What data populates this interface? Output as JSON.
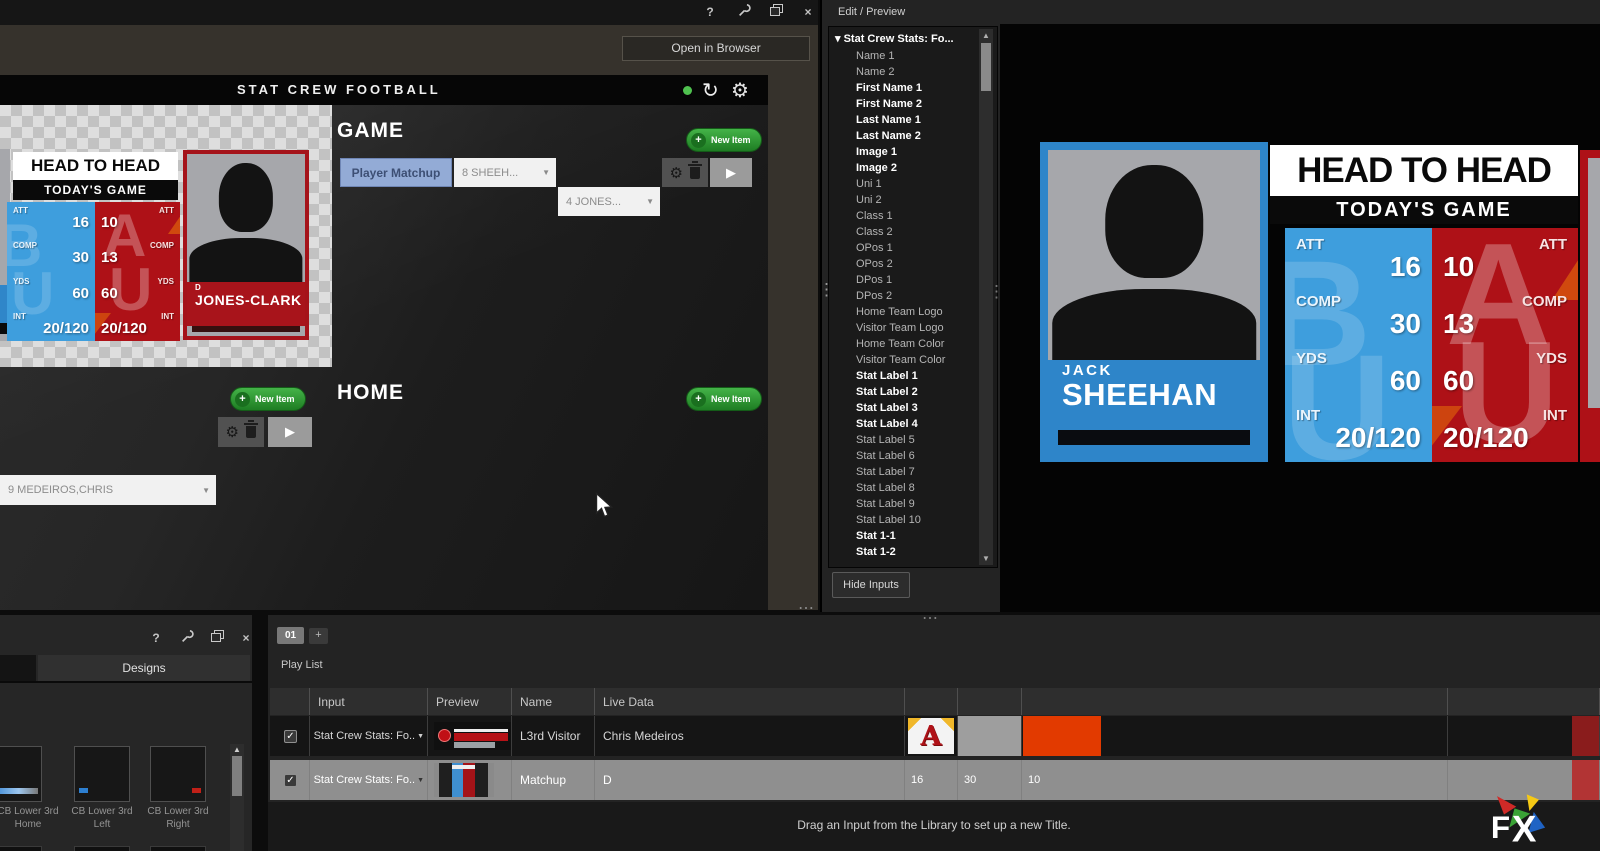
{
  "icons": {
    "help": "?",
    "close": "×",
    "refresh": "↻",
    "gear": "⚙",
    "play": "▶",
    "dropdown_arrow": "▼",
    "collapse_arrow": "▾",
    "scroll_up": "▲",
    "scroll_down": "▼",
    "check": "✓",
    "add": "+",
    "dots_v": "⋮",
    "dots_h": "⋯"
  },
  "colors": {
    "accent_green": "#2f9b32",
    "chip_blue": "#93abd6",
    "team_blue": "#3e9edd",
    "team_red": "#ae1117",
    "orange_swatch": "#e23a00",
    "status_green": "#4fc14f"
  },
  "window": {
    "title": "STAT CREW FOOTBALL",
    "open_in_browser": "Open in Browser",
    "new_item_label": "New Item",
    "game": {
      "heading": "GAME",
      "item_label": "Player Matchup",
      "player1_dd": "8 SHEEH...",
      "player2_dd": "4 JONES..."
    },
    "home": {
      "heading": "HOME"
    },
    "visitor_row": {
      "player_dd": "9 MEDEIROS,CHRIS"
    }
  },
  "graphic": {
    "title": "HEAD TO HEAD",
    "subtitle": "TODAY'S GAME",
    "stat_labels": [
      "ATT",
      "COMP",
      "YDS",
      "INT"
    ],
    "home_values": [
      "16",
      "30",
      "60",
      "20/120"
    ],
    "visitor_values": [
      "10",
      "13",
      "60",
      "20/120"
    ],
    "home_player": {
      "first": "JACK",
      "last": "SHEEHAN"
    },
    "visitor_player": {
      "first": "D",
      "last": "JONES-CLARK"
    }
  },
  "edit_preview": {
    "panel_title": "Edit / Preview",
    "tree_root": "Stat Crew Stats: Fo...",
    "hide_inputs_label": "Hide Inputs",
    "tree_items": [
      {
        "label": "Name 1",
        "bold": false
      },
      {
        "label": "Name 2",
        "bold": false
      },
      {
        "label": "First Name 1",
        "bold": true
      },
      {
        "label": "First Name 2",
        "bold": true
      },
      {
        "label": "Last Name 1",
        "bold": true
      },
      {
        "label": "Last Name 2",
        "bold": true
      },
      {
        "label": "Image 1",
        "bold": true
      },
      {
        "label": "Image 2",
        "bold": true
      },
      {
        "label": "Uni 1",
        "bold": false
      },
      {
        "label": "Uni 2",
        "bold": false
      },
      {
        "label": "Class 1",
        "bold": false
      },
      {
        "label": "Class 2",
        "bold": false
      },
      {
        "label": "OPos 1",
        "bold": false
      },
      {
        "label": "OPos 2",
        "bold": false
      },
      {
        "label": "DPos 1",
        "bold": false
      },
      {
        "label": "DPos 2",
        "bold": false
      },
      {
        "label": "Home Team Logo",
        "bold": false
      },
      {
        "label": "Visitor Team Logo",
        "bold": false
      },
      {
        "label": "Home Team Color",
        "bold": false
      },
      {
        "label": "Visitor Team Color",
        "bold": false
      },
      {
        "label": "Stat Label 1",
        "bold": true
      },
      {
        "label": "Stat Label 2",
        "bold": true
      },
      {
        "label": "Stat Label 3",
        "bold": true
      },
      {
        "label": "Stat Label 4",
        "bold": true
      },
      {
        "label": "Stat Label 5",
        "bold": false
      },
      {
        "label": "Stat Label 6",
        "bold": false
      },
      {
        "label": "Stat Label 7",
        "bold": false
      },
      {
        "label": "Stat Label 8",
        "bold": false
      },
      {
        "label": "Stat Label 9",
        "bold": false
      },
      {
        "label": "Stat Label 10",
        "bold": false
      },
      {
        "label": "Stat 1-1",
        "bold": true
      },
      {
        "label": "Stat 1-2",
        "bold": true
      }
    ]
  },
  "designs": {
    "tab_label": "Designs",
    "items": [
      {
        "line1": "CB Lower 3rd",
        "line2": "Home",
        "accent": "blue-bar"
      },
      {
        "line1": "CB Lower 3rd",
        "line2": "Left",
        "accent": "blue-dot"
      },
      {
        "line1": "CB Lower 3rd",
        "line2": "Right",
        "accent": "red-dot"
      }
    ]
  },
  "playlist": {
    "tab": "01",
    "add_tab": "+",
    "title": "Play List",
    "columns": [
      "Input",
      "Preview",
      "Name",
      "Live Data"
    ],
    "rows": [
      {
        "checked": true,
        "input": "Stat Crew Stats: Fo..",
        "name": "L3rd Visitor",
        "live_data": "Chris Medeiros",
        "thumb": "l3rd-red",
        "cells": [
          {
            "type": "logo",
            "label": "A"
          },
          {
            "type": "swatch",
            "color": "#9e9e9e",
            "fill": "cell"
          },
          {
            "type": "swatch",
            "color": "#e23a00",
            "fill": "left"
          },
          {
            "type": "swatch",
            "color": "#8a1c1c",
            "fill": "right"
          }
        ]
      },
      {
        "checked": true,
        "input": "Stat Crew Stats: Fo..",
        "name": "Matchup",
        "live_data": "D",
        "thumb": "matchup",
        "cells": [
          {
            "type": "text",
            "value": "16"
          },
          {
            "type": "text",
            "value": "30"
          },
          {
            "type": "text",
            "value": "10"
          },
          {
            "type": "swatch",
            "color": "#b23434",
            "fill": "right"
          }
        ]
      }
    ],
    "footer_hint": "Drag an Input from the Library to set up a new Title."
  }
}
